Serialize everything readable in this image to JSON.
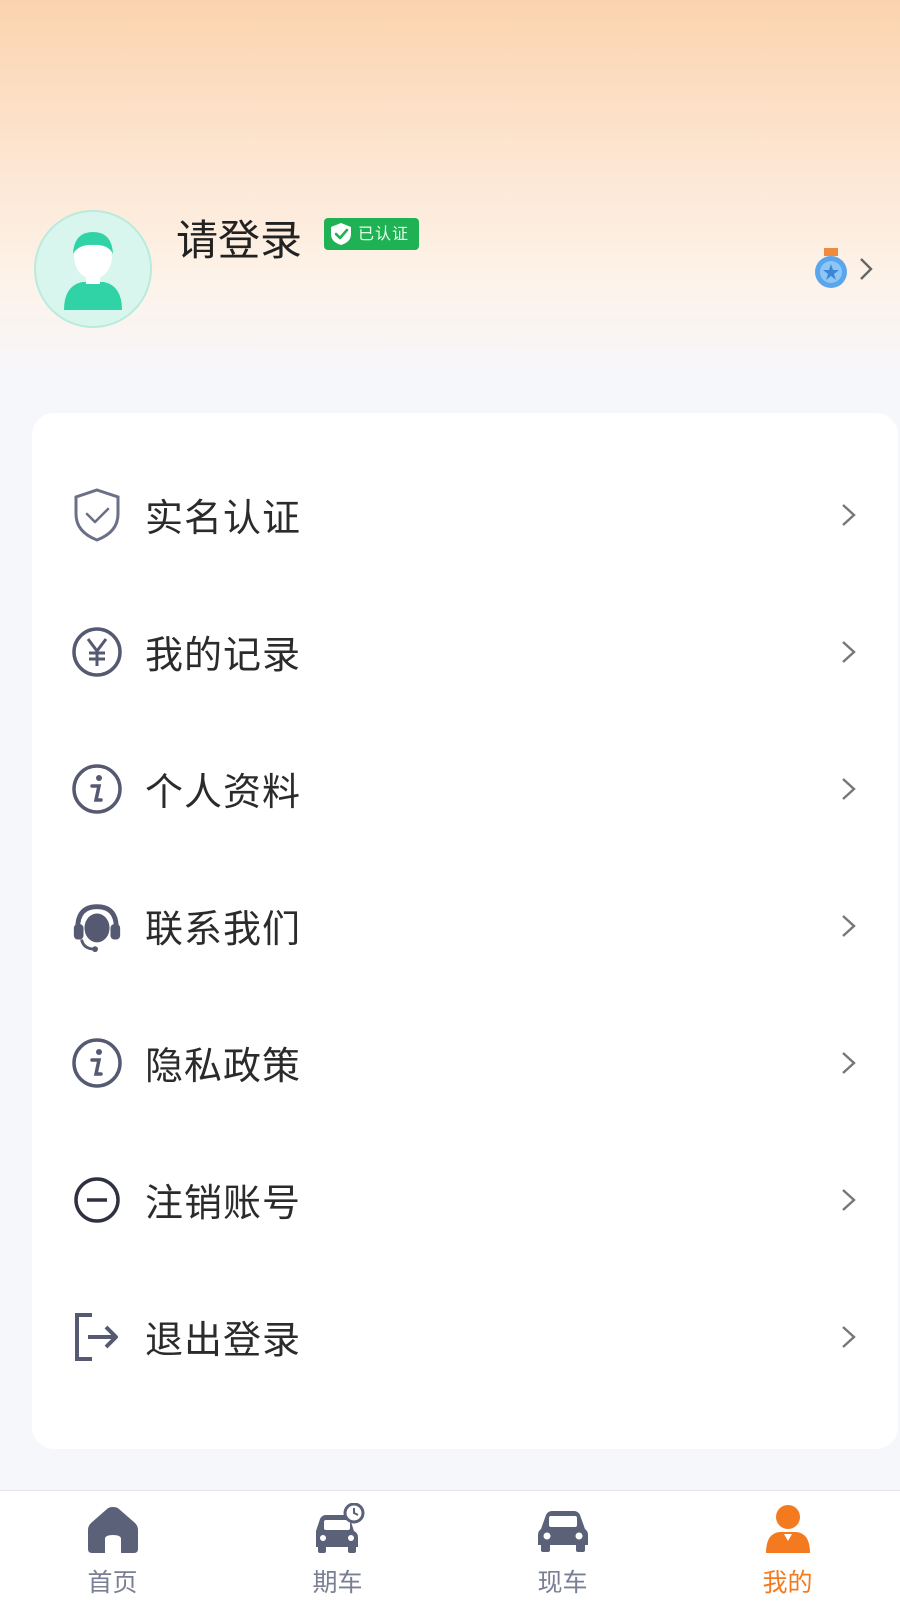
{
  "profile": {
    "login_text": "请登录",
    "verified_badge_text": "已认证"
  },
  "menu": {
    "items": [
      {
        "label": "实名认证",
        "icon": "shield-check-icon"
      },
      {
        "label": "我的记录",
        "icon": "yen-circle-icon"
      },
      {
        "label": "个人资料",
        "icon": "info-circle-icon"
      },
      {
        "label": "联系我们",
        "icon": "headset-icon"
      },
      {
        "label": "隐私政策",
        "icon": "info-circle-icon"
      },
      {
        "label": "注销账号",
        "icon": "minus-circle-icon"
      },
      {
        "label": "退出登录",
        "icon": "logout-icon"
      }
    ]
  },
  "tabbar": {
    "tabs": [
      {
        "label": "首页",
        "icon": "home-icon"
      },
      {
        "label": "期车",
        "icon": "car-clock-icon"
      },
      {
        "label": "现车",
        "icon": "car-icon"
      },
      {
        "label": "我的",
        "icon": "user-icon",
        "active": true
      }
    ]
  },
  "colors": {
    "accent": "#f47a1f",
    "verified": "#1fb255",
    "icon": "#555a72",
    "tab_icon": "#5a6178"
  }
}
